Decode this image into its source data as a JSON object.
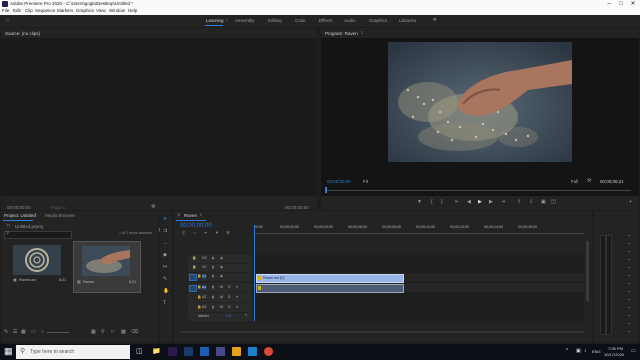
{
  "window": {
    "title": "Adobe Premiere Pro 2020 - C:\\Users\\gogla\\Desktop\\Untitled *",
    "minimize": "–",
    "maximize": "□",
    "close": "✕"
  },
  "menu": [
    "File",
    "Edit",
    "Clip",
    "Sequence",
    "Markers",
    "Graphics",
    "View",
    "Window",
    "Help"
  ],
  "workspaces": {
    "items": [
      "Learning",
      "Assembly",
      "Editing",
      "Color",
      "Effects",
      "Audio",
      "Graphics",
      "Libraries"
    ],
    "active": "Learning",
    "overflow": "»"
  },
  "source_monitor": {
    "title": "Source: (no clips)",
    "timecode_left": "00;00;00;00",
    "page": "Page 1",
    "timecode_right": "00;00;00;00"
  },
  "program_monitor": {
    "title": "Program: Raven",
    "timecode_left": "00;00;00;00",
    "zoom": "Fit",
    "quality": "Full",
    "timecode_right": "00;00;08;21"
  },
  "project_panel": {
    "tabs": [
      "Project: Untitled",
      "Media Browser"
    ],
    "file_name": "Untitled.prproj",
    "items_selected": "1 of 2 items selected",
    "items": [
      {
        "name": "Raven.avi",
        "duration": "8;21"
      },
      {
        "name": "Raven",
        "duration": "8;21"
      }
    ]
  },
  "timeline": {
    "tab_label": "Raven",
    "timecode": "00;00;00;00",
    "ruler": [
      "00;00",
      "00;00;02;00",
      "00;00;04;00",
      "00;00;06;00",
      "00;00;08;00",
      "00;00;10;00",
      "00;00;12;00",
      "00;00;14;00",
      "00;00;16;00"
    ],
    "video_tracks": [
      "V3",
      "V2",
      "V1"
    ],
    "audio_tracks": [
      "A1",
      "A2",
      "A3"
    ],
    "master_label": "Master",
    "master_value": "0.0",
    "video_clip_label": "Raven.avi [V]",
    "track_buttons": [
      "M",
      "S"
    ]
  },
  "taskbar": {
    "search_placeholder": "Type here to search",
    "lang": "ENG",
    "time": "7:06 PM",
    "date": "10/17/2020"
  },
  "colors": {
    "accent_blue": "#2f7bd7",
    "clip_video": "#9ab6e8",
    "clip_audio": "#4b5c74",
    "playhead": "#2f7bd7"
  }
}
